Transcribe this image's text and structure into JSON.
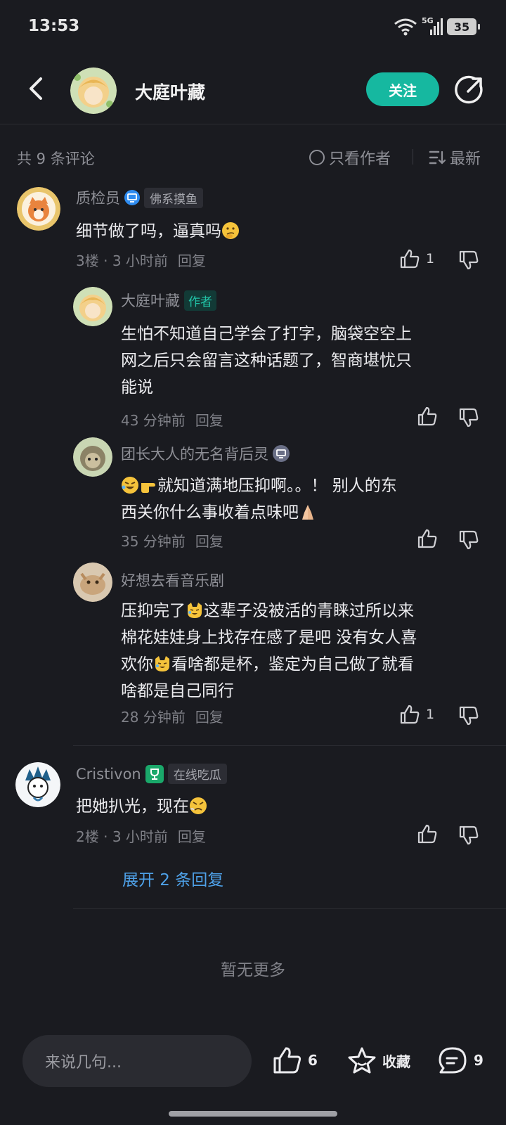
{
  "status_bar": {
    "time": "13:53",
    "network": "5G",
    "battery": "35"
  },
  "header": {
    "title": "大庭叶藏",
    "follow_label": "关注"
  },
  "filter": {
    "count_label": "共 9 条评论",
    "only_author_label": "只看作者",
    "sort_label": "最新"
  },
  "comments": [
    {
      "user": "质检员",
      "badge": "佛系摸鱼",
      "text": "细节做了吗，逼真吗",
      "floor": "3楼",
      "time": "3 小时前",
      "reply_label": "回复",
      "likes": "1"
    },
    {
      "user": "大庭叶藏",
      "author_tag": "作者",
      "text_lines": [
        "生怕不知道自己学会了打字，脑袋空空上",
        "网之后只会留言这种话题了，智商堪忧只",
        "能说"
      ],
      "time": "43 分钟前",
      "reply_label": "回复"
    },
    {
      "user": "团长大人的无名背后灵",
      "text_lines": [
        "就知道满地压抑啊。。！ 别人的东",
        "西关你什么事收着点味吧"
      ],
      "time": "35 分钟前",
      "reply_label": "回复"
    },
    {
      "user": "好想去看音乐剧",
      "text_lines": [
        "压抑完了",
        "这辈子没被活的青睐过所以来",
        "棉花娃娃身上找存在感了是吧 没有女人喜",
        "欢你",
        "看啥都是杯，鉴定为自己做了就看",
        "啥都是自己同行"
      ],
      "time": "28 分钟前",
      "reply_label": "回复",
      "likes": "1"
    },
    {
      "user": "Cristivon",
      "badge": "在线吃瓜",
      "text": "把她扒光，现在",
      "floor": "2楼",
      "time": "3 小时前",
      "reply_label": "回复"
    }
  ],
  "expand_label": "展开 2 条回复",
  "no_more_label": "暂无更多",
  "bottom_bar": {
    "input_placeholder": "来说几句...",
    "like_count": "6",
    "favorite_label": "收藏",
    "comment_count": "9"
  },
  "colors": {
    "background": "#1a1b20",
    "accent": "#16b8a0",
    "link": "#4ea1e8"
  }
}
